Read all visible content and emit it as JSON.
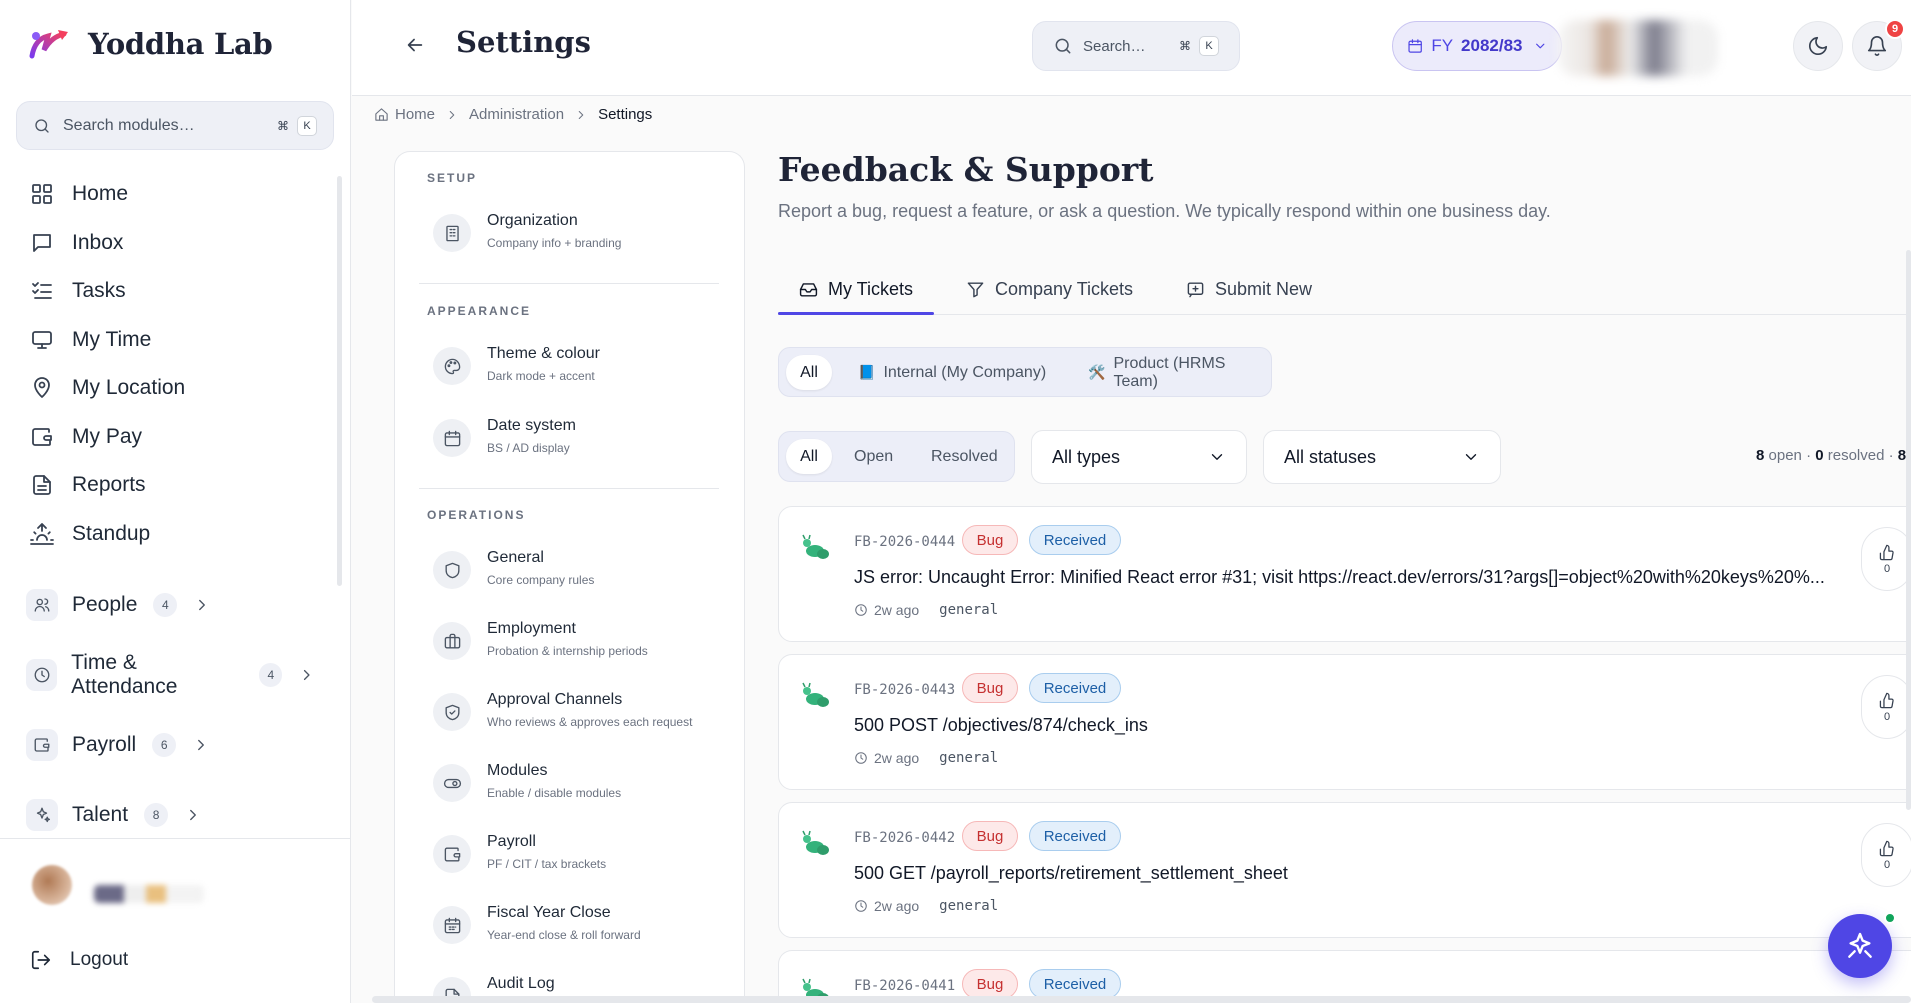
{
  "brand": {
    "name": "Yoddha Lab"
  },
  "sidebar": {
    "search_placeholder": "Search modules…",
    "shortcut": [
      "⌘",
      "K"
    ],
    "nav": [
      {
        "label": "Home",
        "icon": "grid-icon"
      },
      {
        "label": "Inbox",
        "icon": "message-icon"
      },
      {
        "label": "Tasks",
        "icon": "list-check-icon"
      },
      {
        "label": "My Time",
        "icon": "monitor-icon"
      },
      {
        "label": "My Location",
        "icon": "map-pin-icon"
      },
      {
        "label": "My Pay",
        "icon": "wallet-icon"
      },
      {
        "label": "Reports",
        "icon": "file-text-icon"
      },
      {
        "label": "Standup",
        "icon": "sunrise-icon"
      }
    ],
    "groups": [
      {
        "label": "People",
        "count": "4"
      },
      {
        "label": "Time & Attendance",
        "count": "4"
      },
      {
        "label": "Payroll",
        "count": "6"
      },
      {
        "label": "Talent",
        "count": "8"
      }
    ],
    "logout": "Logout"
  },
  "header": {
    "title": "Settings",
    "search_placeholder": "Search…",
    "shortcut": [
      "⌘",
      "K"
    ],
    "fy_prefix": "FY",
    "fy_value": "2082/83",
    "notification_count": "9"
  },
  "breadcrumb": {
    "items": [
      "Home",
      "Administration",
      "Settings"
    ]
  },
  "settings_nav": {
    "sections": [
      {
        "heading": "SETUP",
        "items": [
          {
            "title": "Organization",
            "desc": "Company info + branding"
          }
        ]
      },
      {
        "heading": "APPEARANCE",
        "items": [
          {
            "title": "Theme & colour",
            "desc": "Dark mode + accent"
          },
          {
            "title": "Date system",
            "desc": "BS / AD display"
          }
        ]
      },
      {
        "heading": "OPERATIONS",
        "items": [
          {
            "title": "General",
            "desc": "Core company rules"
          },
          {
            "title": "Employment",
            "desc": "Probation & internship periods"
          },
          {
            "title": "Approval Channels",
            "desc": "Who reviews & approves each request"
          },
          {
            "title": "Modules",
            "desc": "Enable / disable modules"
          },
          {
            "title": "Payroll",
            "desc": "PF / CIT / tax brackets"
          },
          {
            "title": "Fiscal Year Close",
            "desc": "Year-end close & roll forward"
          },
          {
            "title": "Audit Log",
            "desc": ""
          }
        ]
      }
    ]
  },
  "main": {
    "title": "Feedback & Support",
    "subtitle": "Report a bug, request a feature, or ask a question. We typically respond within one business day.",
    "tabs": [
      {
        "label": "My Tickets",
        "icon": "inbox-icon"
      },
      {
        "label": "Company Tickets",
        "icon": "filter-icon"
      },
      {
        "label": "Submit New",
        "icon": "message-plus-icon"
      }
    ],
    "scope_filter": {
      "all": "All",
      "internal": "Internal (My Company)",
      "internal_icon": "📘",
      "product": "Product (HRMS Team)",
      "product_icon": "🛠️"
    },
    "status_filter": [
      "All",
      "Open",
      "Resolved"
    ],
    "type_select": "All types",
    "status_select": "All statuses",
    "counts": {
      "open": "8",
      "open_label": "open",
      "resolved": "0",
      "resolved_label": "resolved",
      "total": "8",
      "sep": "·"
    },
    "tickets": [
      {
        "id": "FB-2026-0444",
        "type": "Bug",
        "status": "Received",
        "title": "JS error: Uncaught Error: Minified React error #31; visit https://react.dev/errors/31?args[]=object%20with%20keys%20%...",
        "age": "2w ago",
        "category": "general",
        "votes": "0"
      },
      {
        "id": "FB-2026-0443",
        "type": "Bug",
        "status": "Received",
        "title": "500 POST /objectives/874/check_ins",
        "age": "2w ago",
        "category": "general",
        "votes": "0"
      },
      {
        "id": "FB-2026-0442",
        "type": "Bug",
        "status": "Received",
        "title": "500 GET /payroll_reports/retirement_settlement_sheet",
        "age": "2w ago",
        "category": "general",
        "votes": "0"
      },
      {
        "id": "FB-2026-0441",
        "type": "Bug",
        "status": "Received",
        "title": "",
        "age": "",
        "category": "",
        "votes": ""
      }
    ]
  },
  "colors": {
    "accent": "#4f46e5",
    "bug": "#c53030",
    "received": "#1d5fa6",
    "online": "#10a45b"
  }
}
